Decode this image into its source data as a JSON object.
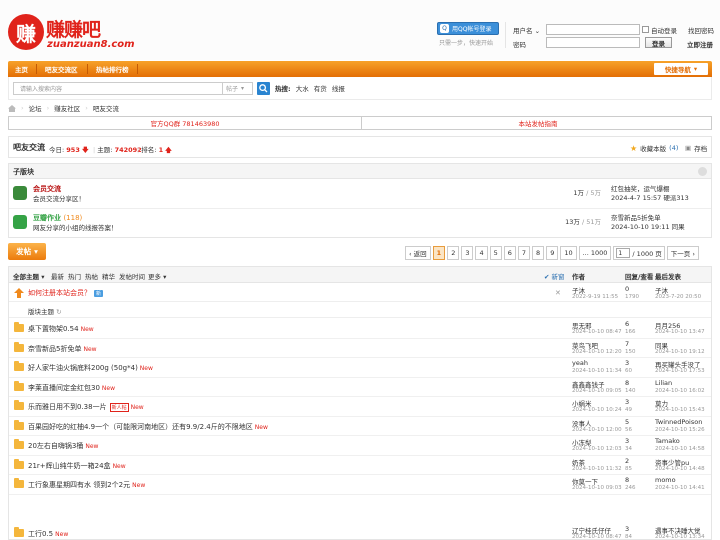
{
  "logo": {
    "glyph": "赚",
    "title": "赚赚吧",
    "subtitle": "zuanzuan8.com"
  },
  "login": {
    "qq_button": "用QQ帐号登录",
    "qq_glyph": "Q",
    "qq_tip": "只需一步，快速开始",
    "username_label": "用户名",
    "password_label": "密码",
    "remember": "自动登录",
    "forgot": "找回密码",
    "login_button": "登录",
    "register": "立即注册"
  },
  "nav": {
    "items": [
      "主页",
      "吧友交流区",
      "热帖排行榜"
    ],
    "quick": "快捷导航"
  },
  "search": {
    "placeholder": "请输入搜索内容",
    "type": "帖子",
    "hot_label": "热搜:",
    "hot": [
      "大水",
      "有货",
      "线报"
    ]
  },
  "breadcrumb": [
    "论坛",
    "赚友社区",
    "吧友交流"
  ],
  "ads": {
    "left": "官方QQ群 781463980",
    "right": "本站发帖指南"
  },
  "forum": {
    "title": "吧友交流",
    "today_label": "今日:",
    "today": "953",
    "topics_label": "主题:",
    "topics": "742092",
    "rank_label": "排名:",
    "rank": "1",
    "fav": "收藏本版",
    "fav_count": "(4)",
    "save": "存档"
  },
  "subforums": {
    "title": "子版块",
    "rows": [
      {
        "name": "会员交流",
        "desc": "会员交流分享区！",
        "count": "1万",
        "total": " / 5万",
        "last_title": "红包抽奖，运气爆棚",
        "last_info": "2024-4-7 15:57 硬派313",
        "color": "#b91414"
      },
      {
        "name": "豆瓣作业",
        "name_count": "(118)",
        "desc": "网友分享的小组的线报答案！",
        "count": "13万",
        "total": " / 51万",
        "last_title": "奈雪新品5折免单",
        "last_info": "2024-10-10 19:11 同果",
        "color": "#35a346"
      }
    ]
  },
  "toolbar": {
    "post": "发帖",
    "pages": [
      "‹ 返回",
      "1",
      "2",
      "3",
      "4",
      "5",
      "6",
      "7",
      "8",
      "9",
      "10",
      "... 1000"
    ],
    "page_input": "1",
    "page_total": "/ 1000 页",
    "next": "下一页 ›"
  },
  "list_header": {
    "filters": [
      "全部主题",
      "最新",
      "热门",
      "热帖",
      "精华",
      "发帖时间",
      "更多"
    ],
    "new_label": "新窗",
    "col_author": "作者",
    "col_reply": "回复/查看",
    "col_last": "最后发表"
  },
  "sticky": {
    "title": "如何注册本站会员？",
    "badge": "新",
    "author": "子沐",
    "author_date": "2022-9-19 11:55",
    "replies": "0",
    "views": "1790",
    "last": "子沐",
    "last_date": "2023-7-20 20:50"
  },
  "section_title": "版块主题",
  "threads": [
    {
      "title": "桌下置物架0.54",
      "author": "思无邪",
      "date": "2024-10-10 08:47",
      "replies": "6",
      "views": "166",
      "last": "月月256",
      "last_date": "2024-10-10 13:47"
    },
    {
      "title": "奈雪新品5折免单",
      "author": "菜鸟飞吧",
      "date": "2024-10-10 12:20",
      "replies": "7",
      "views": "150",
      "last": "同果",
      "last_date": "2024-10-10 19:12"
    },
    {
      "title": "好人家牛油火锅底料200g (50g*4)",
      "author": "yeah",
      "date": "2024-10-10 11:34",
      "replies": "3",
      "views": "60",
      "last": "再买罐头手没了",
      "last_date": "2024-10-10 17:53"
    },
    {
      "title": "李莱直播间定金红包30",
      "author": "鑫鑫鑫钱子",
      "date": "2024-10-10 09:05",
      "replies": "8",
      "views": "140",
      "last": "Lilian",
      "last_date": "2024-10-10 16:02"
    },
    {
      "title": "乐而雅日用不到0.38一片",
      "tag": "新人帖",
      "author": "小蜗米",
      "date": "2024-10-10 10:24",
      "replies": "3",
      "views": "49",
      "last": "莫力",
      "last_date": "2024-10-10 15:43"
    },
    {
      "title": "百果园好吃的红柚4.9一个（可能限河南地区）还有9.9/2.4斤的不限地区",
      "author": "没事人",
      "date": "2024-10-10 12:00",
      "replies": "5",
      "views": "56",
      "last": "TwinnedPoison",
      "last_date": "2024-10-10 15:26"
    },
    {
      "title": "20左右自嗨锅3桶",
      "author": "小冻梨",
      "date": "2024-10-10 12:03",
      "replies": "3",
      "views": "34",
      "last": "Tamako",
      "last_date": "2024-10-10 14:58"
    },
    {
      "title": "21r+辉山纯牛奶一箱24盒",
      "author": "奶茶",
      "date": "2024-10-10 11:32",
      "replies": "2",
      "views": "85",
      "last": "资事少管pu",
      "last_date": "2024-10-10 14:48"
    },
    {
      "title": "工行象惠星期四有水 领到2个2元",
      "author": "你莫一下",
      "date": "2024-10-10 09:03",
      "replies": "8",
      "views": "246",
      "last": "momo",
      "last_date": "2024-10-10 14:41"
    },
    {
      "title": "工行0.5",
      "author": "辽宁桂氏仔仔",
      "date": "2024-10-10 08:47",
      "replies": "3",
      "views": "84",
      "last": "遇事不决睡大觉",
      "last_date": "2024-10-10 13:34"
    }
  ],
  "new_label": "New",
  "colors": {
    "accent": "#e36e06",
    "brand_red": "#e0231b",
    "link_blue": "#2a6fb0"
  }
}
